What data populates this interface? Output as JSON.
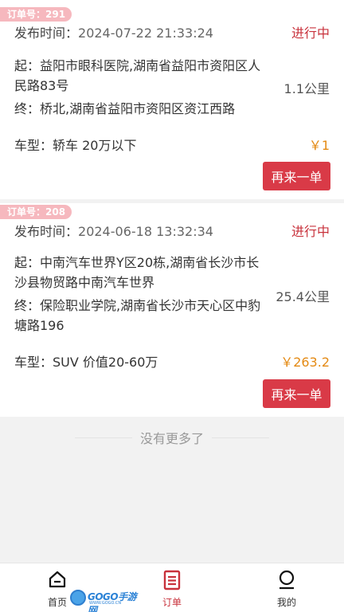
{
  "orders": [
    {
      "badge": "订单号：291",
      "time_label": "发布时间：",
      "time_value": "2024-07-22 21:33:24",
      "status": "进行中",
      "from": "起：益阳市眼科医院,湖南省益阳市资阳区人民路83号",
      "to": "终：桥北,湖南省益阳市资阳区资江西路",
      "distance": "1.1公里",
      "vehicle": "车型：轿车 20万以下",
      "price": "￥1",
      "button": "再来一单"
    },
    {
      "badge": "订单号：208",
      "time_label": "发布时间：",
      "time_value": "2024-06-18 13:32:34",
      "status": "进行中",
      "from": "起：中南汽车世界Y区20栋,湖南省长沙市长沙县物贸路中南汽车世界",
      "to": "终：保险职业学院,湖南省长沙市天心区中豹塘路196",
      "distance": "25.4公里",
      "vehicle": "车型：SUV 价值20-60万",
      "price": "￥263.2",
      "button": "再来一单"
    }
  ],
  "no_more": "没有更多了",
  "tabbar": {
    "home": "首页",
    "orders": "订单",
    "mine": "我的"
  },
  "watermark": {
    "text": "GOGO手游网",
    "sub": "WWW.GOGO.CN"
  },
  "colors": {
    "accent": "#c8323c",
    "button": "#d93a47",
    "badge": "#f6b8be",
    "price": "#e48a14"
  },
  "icons": {
    "home": "home-icon",
    "orders": "order-list-icon",
    "mine": "user-icon"
  }
}
